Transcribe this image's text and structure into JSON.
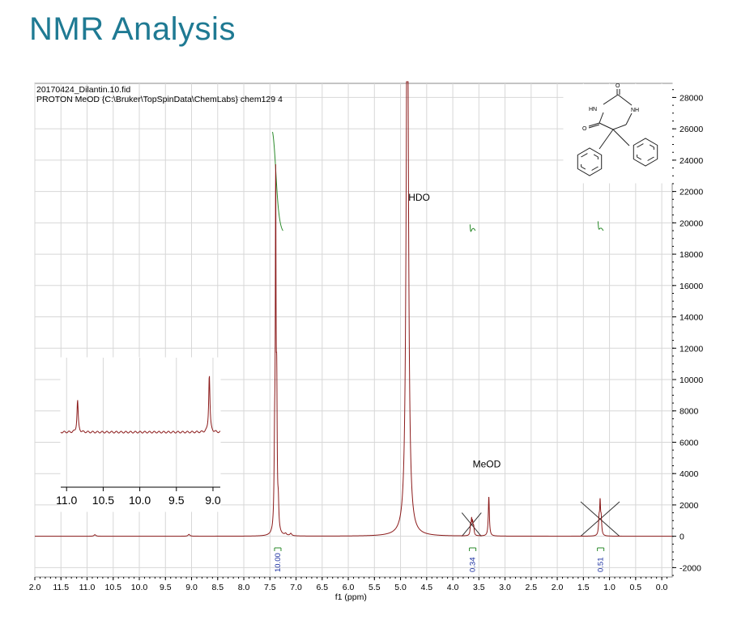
{
  "page_title": "NMR Analysis",
  "chart_data": {
    "type": "line",
    "title": "",
    "header_lines": [
      "20170424_Dilantin.10.fid",
      "PROTON MeOD {C:\\Bruker\\TopSpinData\\ChemLabs} chem129 4"
    ],
    "xlabel": "f1 (ppm)",
    "ylabel": "",
    "x_reversed": true,
    "xlim": [
      12.0,
      -0.2
    ],
    "ylim": [
      -2600,
      28900
    ],
    "x_ticks": [
      12.0,
      11.5,
      11.0,
      10.5,
      10.0,
      9.5,
      9.0,
      8.5,
      8.0,
      7.5,
      7.0,
      6.5,
      6.0,
      5.5,
      5.0,
      4.5,
      4.0,
      3.5,
      3.0,
      2.5,
      2.0,
      1.5,
      1.0,
      0.5,
      0.0
    ],
    "x_tick_labels": [
      "2.0",
      "11.5",
      "11.0",
      "10.5",
      "10.0",
      "9.5",
      "9.0",
      "8.5",
      "8.0",
      "7.5",
      "7.0",
      "6.5",
      "6.0",
      "5.5",
      "5.0",
      "4.5",
      "4.0",
      "3.5",
      "3.0",
      "2.5",
      "2.0",
      "1.5",
      "1.0",
      "0.5",
      "0.0"
    ],
    "y_ticks": [
      -2000,
      0,
      2000,
      4000,
      6000,
      8000,
      10000,
      12000,
      14000,
      16000,
      18000,
      20000,
      22000,
      24000,
      26000,
      28000
    ],
    "grid": true,
    "peaks": [
      {
        "ppm": 10.85,
        "height": 100,
        "width": 0.02
      },
      {
        "ppm": 9.05,
        "height": 120,
        "width": 0.02
      },
      {
        "ppm": 7.41,
        "height": 5000,
        "width": 0.012
      },
      {
        "ppm": 7.39,
        "height": 20800,
        "width": 0.008
      },
      {
        "ppm": 7.37,
        "height": 8000,
        "width": 0.01
      },
      {
        "ppm": 7.34,
        "height": 1500,
        "width": 0.012
      },
      {
        "ppm": 7.2,
        "height": 120,
        "width": 0.02
      },
      {
        "ppm": 7.1,
        "height": 150,
        "width": 0.02
      },
      {
        "ppm": 4.87,
        "height": 40000,
        "width": 0.025
      },
      {
        "ppm": 3.66,
        "height": 600,
        "width": 0.01
      },
      {
        "ppm": 3.64,
        "height": 900,
        "width": 0.01
      },
      {
        "ppm": 3.62,
        "height": 700,
        "width": 0.01
      },
      {
        "ppm": 3.6,
        "height": 500,
        "width": 0.01
      },
      {
        "ppm": 3.31,
        "height": 2500,
        "width": 0.012
      },
      {
        "ppm": 1.2,
        "height": 1000,
        "width": 0.012
      },
      {
        "ppm": 1.18,
        "height": 1900,
        "width": 0.01
      },
      {
        "ppm": 1.16,
        "height": 1000,
        "width": 0.012
      }
    ],
    "annotations": [
      {
        "text": "HDO",
        "ppm": 4.85,
        "y": 21400
      },
      {
        "text": "MeOD",
        "ppm": 3.62,
        "y": 4400
      }
    ],
    "integrals": [
      {
        "value": "10.00",
        "from": 7.25,
        "to": 7.45,
        "curve_y": [
          19500,
          25800
        ]
      },
      {
        "value": "0.34",
        "from": 3.57,
        "to": 3.67,
        "curve_y": [
          19500,
          19900
        ]
      },
      {
        "value": "0.51",
        "from": 1.12,
        "to": 1.22,
        "curve_y": [
          19500,
          20100
        ]
      }
    ],
    "inset": {
      "xlim": [
        11.08,
        8.9
      ],
      "tick_values": [
        11.0,
        10.5,
        10.0,
        9.5,
        9.0
      ],
      "tick_labels": [
        "11.0",
        "10.5",
        "10.0",
        "9.5",
        "9.0"
      ],
      "peaks": [
        {
          "ppm": 10.85,
          "rel_height": 0.55
        },
        {
          "ppm": 9.05,
          "rel_height": 1.0
        }
      ]
    },
    "structure": {
      "labels": [
        "O",
        "HN",
        "NH",
        "O"
      ]
    },
    "colors": {
      "spectrum": "#8b1a1a",
      "integral": "#2a8a2a",
      "integral_value": "#1a2fa0",
      "grid": "#d7d7d7",
      "title": "#1f7a93"
    }
  }
}
